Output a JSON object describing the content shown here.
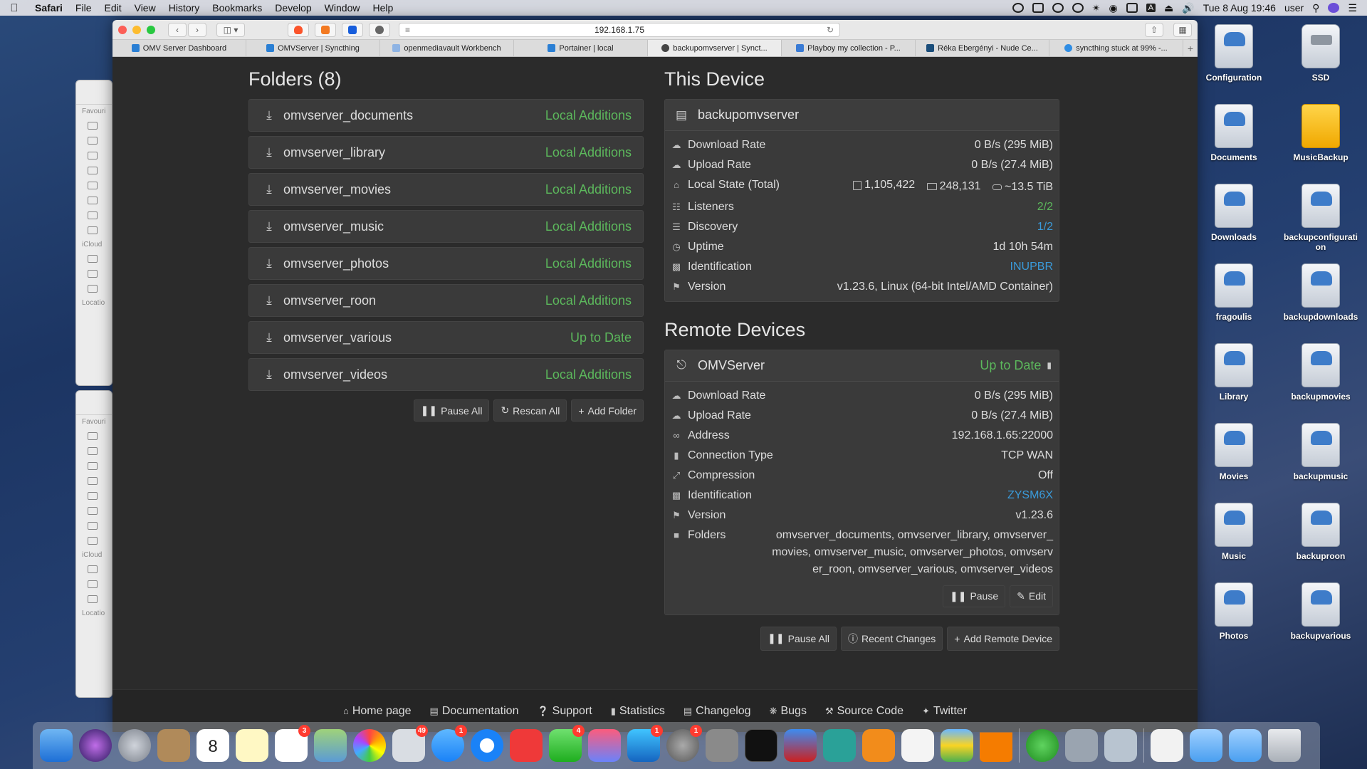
{
  "menubar": {
    "app": "Safari",
    "items": [
      "File",
      "Edit",
      "View",
      "History",
      "Bookmarks",
      "Develop",
      "Window",
      "Help"
    ],
    "clock": "Tue 8 Aug  19:46",
    "user": "user"
  },
  "browser": {
    "url": "192.168.1.75",
    "tabs": [
      "OMV Server Dashboard",
      "OMVServer | Syncthing",
      "openmediavault Workbench",
      "Portainer | local",
      "backupomvserver | Synct...",
      "Playboy my collection - P...",
      "Réka Ebergényi - Nude Ce...",
      "syncthing stuck at 99% -..."
    ],
    "active_tab": 4
  },
  "folders": {
    "title": "Folders (8)",
    "items": [
      {
        "name": "omvserver_documents",
        "status": "Local Additions"
      },
      {
        "name": "omvserver_library",
        "status": "Local Additions"
      },
      {
        "name": "omvserver_movies",
        "status": "Local Additions"
      },
      {
        "name": "omvserver_music",
        "status": "Local Additions"
      },
      {
        "name": "omvserver_photos",
        "status": "Local Additions"
      },
      {
        "name": "omvserver_roon",
        "status": "Local Additions"
      },
      {
        "name": "omvserver_various",
        "status": "Up to Date"
      },
      {
        "name": "omvserver_videos",
        "status": "Local Additions"
      }
    ],
    "buttons": {
      "pause_all": "Pause All",
      "rescan_all": "Rescan All",
      "add_folder": "Add Folder"
    }
  },
  "this_device": {
    "title": "This Device",
    "name": "backupomvserver",
    "download_label": "Download Rate",
    "download_value": "0 B/s (295 MiB)",
    "upload_label": "Upload Rate",
    "upload_value": "0 B/s (27.4 MiB)",
    "local_state_label": "Local State (Total)",
    "files": "1,105,422",
    "dirs": "248,131",
    "size": "~13.5 TiB",
    "listeners_label": "Listeners",
    "listeners_value": "2/2",
    "discovery_label": "Discovery",
    "discovery_value": "1/2",
    "uptime_label": "Uptime",
    "uptime_value": "1d 10h 54m",
    "id_label": "Identification",
    "id_value": "INUPBR",
    "version_label": "Version",
    "version_value": "v1.23.6, Linux (64-bit Intel/AMD Container)"
  },
  "remote": {
    "title": "Remote Devices",
    "name": "OMVServer",
    "status": "Up to Date",
    "download_label": "Download Rate",
    "download_value": "0 B/s (295 MiB)",
    "upload_label": "Upload Rate",
    "upload_value": "0 B/s (27.4 MiB)",
    "address_label": "Address",
    "address_value": "192.168.1.65:22000",
    "conn_label": "Connection Type",
    "conn_value": "TCP WAN",
    "compression_label": "Compression",
    "compression_value": "Off",
    "id_label": "Identification",
    "id_value": "ZYSM6X",
    "version_label": "Version",
    "version_value": "v1.23.6",
    "folders_label": "Folders",
    "folders_value": "omvserver_documents, omvserver_library, omvserver_movies, omvserver_music, omvserver_photos, omvserver_roon, omvserver_various, omvserver_videos",
    "pause": "Pause",
    "edit": "Edit",
    "buttons": {
      "pause_all": "Pause All",
      "recent_changes": "Recent Changes",
      "add_remote": "Add Remote Device"
    }
  },
  "footer": [
    "Home page",
    "Documentation",
    "Support",
    "Statistics",
    "Changelog",
    "Bugs",
    "Source Code",
    "Twitter"
  ],
  "desktop": [
    "Configuration",
    "SSD",
    "Documents",
    "MusicBackup",
    "Downloads",
    "backupconfiguration",
    "fragoulis",
    "backupdownloads",
    "Library",
    "backupmovies",
    "Movies",
    "backupmusic",
    "Music",
    "backuproon",
    "Photos",
    "backupvarious"
  ],
  "dock_badges": {
    "calendar": "8",
    "reminders": "3",
    "mail": "49",
    "messages": "1",
    "facetime": "4",
    "appstore": "1",
    "sysprefs": "1"
  },
  "colors": {
    "ok_green": "#5cb85c",
    "link_blue": "#3a9ad9",
    "panel": "#3a3a3a",
    "background": "#2b2b2b"
  }
}
